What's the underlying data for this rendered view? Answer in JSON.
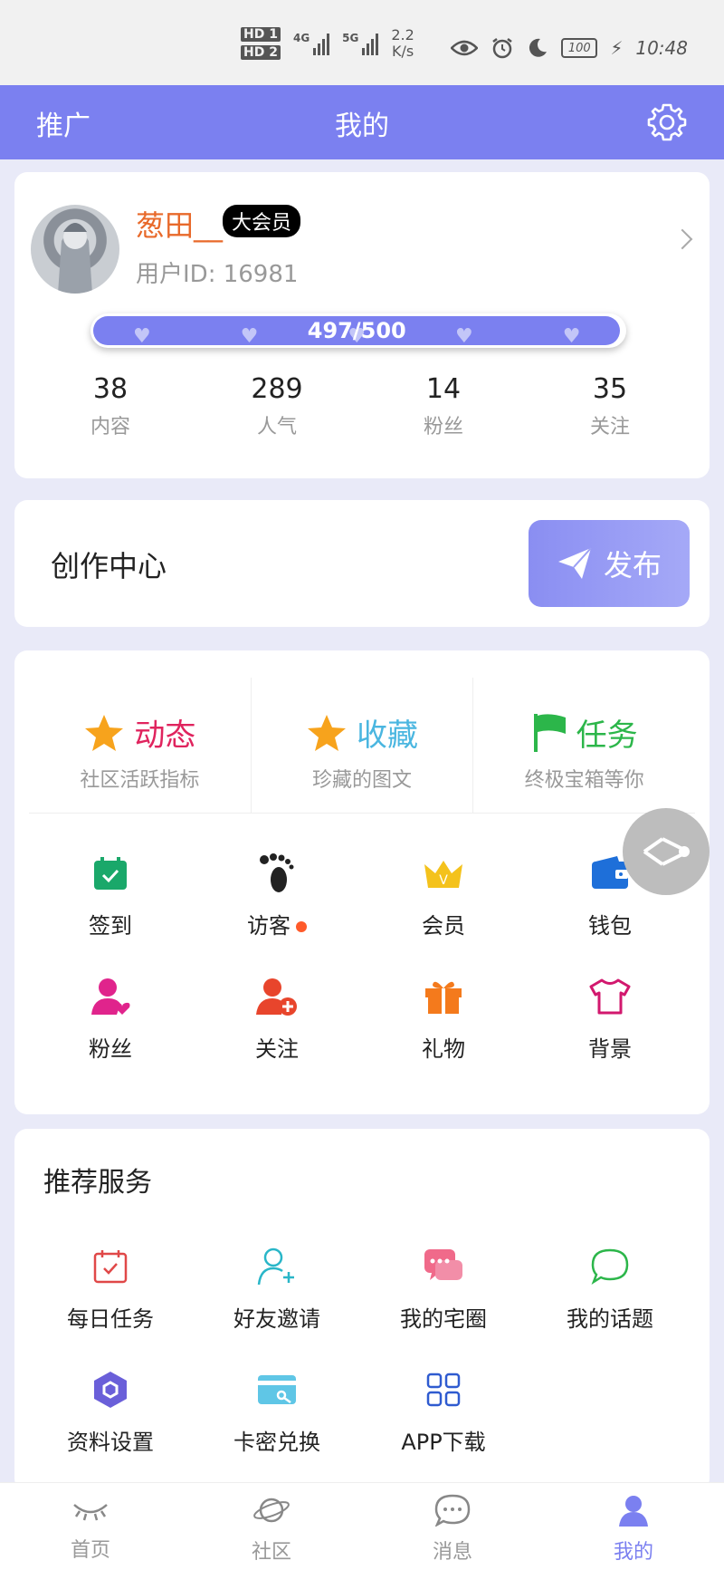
{
  "status_bar": {
    "hd1": "HD",
    "hd1_sub": "1",
    "hd2": "HD",
    "hd2_sub": "2",
    "net1": "4G",
    "net2": "5G",
    "speed_value": "2.2",
    "speed_unit": "K/s",
    "battery": "100",
    "time": "10:48",
    "icons": [
      "eye-icon",
      "alarm-icon",
      "moon-icon",
      "battery-icon",
      "charging-icon"
    ]
  },
  "header": {
    "left_label": "推广",
    "title": "我的",
    "settings_icon": "gear-icon"
  },
  "profile": {
    "username": "葱田__",
    "vip_badge": "大会员",
    "user_id": "用户ID:  16981",
    "progress_text": "497/500",
    "progress_fraction": 0.994,
    "stats": [
      {
        "value": "38",
        "label": "内容"
      },
      {
        "value": "289",
        "label": "人气"
      },
      {
        "value": "14",
        "label": "粉丝"
      },
      {
        "value": "35",
        "label": "关注"
      }
    ]
  },
  "create_center": {
    "title": "创作中心",
    "publish_label": "发布"
  },
  "features": [
    {
      "title": "动态",
      "subtitle": "社区活跃指标",
      "icon": "star-icon",
      "color": "#e0245e"
    },
    {
      "title": "收藏",
      "subtitle": "珍藏的图文",
      "icon": "star-icon",
      "color": "#4ab6e0"
    },
    {
      "title": "任务",
      "subtitle": "终极宝箱等你",
      "icon": "flag-icon",
      "color": "#2cb64a"
    }
  ],
  "grid_row1": [
    {
      "label": "签到",
      "icon": "calendar-check-icon"
    },
    {
      "label": "访客",
      "icon": "footprint-icon"
    },
    {
      "label": "会员",
      "icon": "crown-icon"
    },
    {
      "label": "钱包",
      "icon": "wallet-icon"
    }
  ],
  "grid_row2": [
    {
      "label": "粉丝",
      "icon": "user-heart-icon"
    },
    {
      "label": "关注",
      "icon": "user-add-icon"
    },
    {
      "label": "礼物",
      "icon": "gift-icon"
    },
    {
      "label": "背景",
      "icon": "shirt-icon"
    }
  ],
  "services": {
    "title": "推荐服务",
    "row1": [
      {
        "label": "每日任务",
        "icon": "calendar-task-icon"
      },
      {
        "label": "好友邀请",
        "icon": "invite-user-icon"
      },
      {
        "label": "我的宅圈",
        "icon": "chat-bubbles-icon"
      },
      {
        "label": "我的话题",
        "icon": "speech-bubble-icon"
      }
    ],
    "row2": [
      {
        "label": "资料设置",
        "icon": "hexagon-settings-icon"
      },
      {
        "label": "卡密兑换",
        "icon": "card-key-icon"
      },
      {
        "label": "APP下载",
        "icon": "app-grid-icon"
      }
    ]
  },
  "tabbar": [
    {
      "label": "首页",
      "icon": "eye-closed-icon",
      "active": false
    },
    {
      "label": "社区",
      "icon": "planet-icon",
      "active": false
    },
    {
      "label": "消息",
      "icon": "message-icon",
      "active": false
    },
    {
      "label": "我的",
      "icon": "person-icon",
      "active": true
    }
  ],
  "colors": {
    "accent": "#7b80f0",
    "username": "#e8692a",
    "active_tab": "#7b80f0"
  }
}
